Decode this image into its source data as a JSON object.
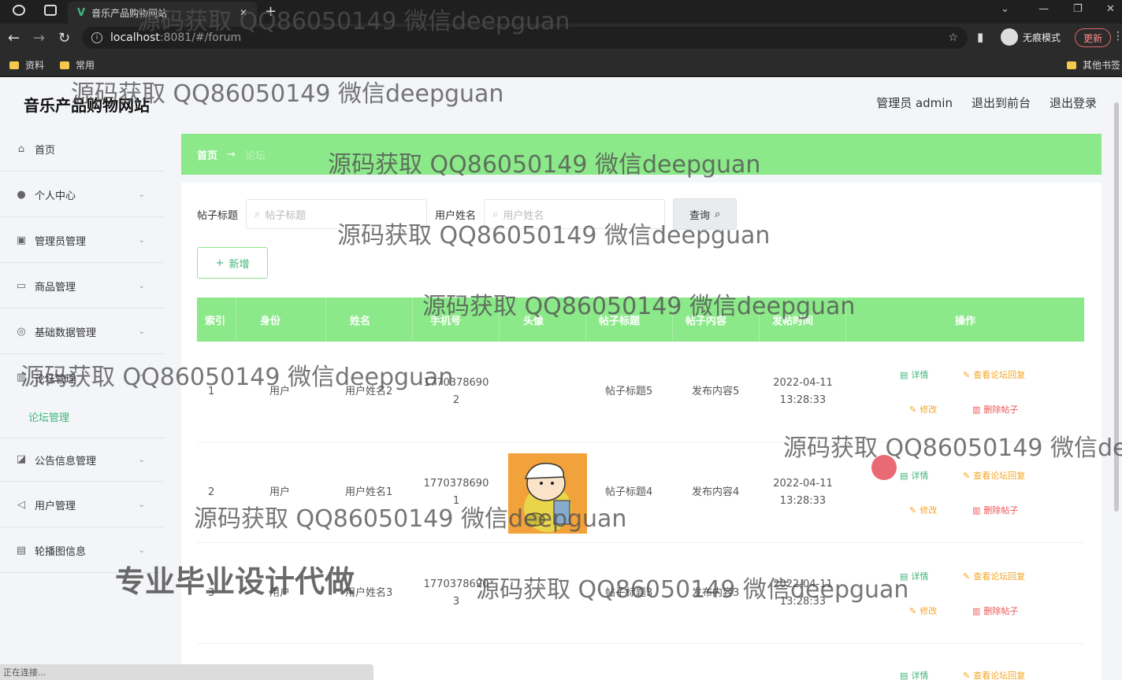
{
  "browser": {
    "tab_title": "音乐产品购物网站",
    "url_host": "localhost",
    "url_rest": ":8081/#/forum",
    "incognito_label": "无痕模式",
    "update_label": "更新",
    "bookmarks": [
      "资料",
      "常用"
    ],
    "other_bookmarks": "其他书签",
    "status_text": "正在连接..."
  },
  "app": {
    "site_title": "音乐产品购物网站",
    "top_links": [
      "管理员 admin",
      "退出到前台",
      "退出登录"
    ]
  },
  "sidebar": {
    "items": [
      {
        "label": "首页",
        "icon": "home-icon"
      },
      {
        "label": "个人中心",
        "icon": "user-icon"
      },
      {
        "label": "管理员管理",
        "icon": "admin-icon"
      },
      {
        "label": "商品管理",
        "icon": "goods-icon"
      },
      {
        "label": "基础数据管理",
        "icon": "data-icon"
      },
      {
        "label": "论坛管理",
        "icon": "forum-icon"
      },
      {
        "label": "公告信息管理",
        "icon": "notice-icon"
      },
      {
        "label": "用户管理",
        "icon": "send-icon"
      },
      {
        "label": "轮播图信息",
        "icon": "carousel-icon"
      }
    ],
    "sub_item": "论坛管理"
  },
  "breadcrumb": {
    "home": "首页",
    "arrow": "→",
    "current": "论坛"
  },
  "search": {
    "title_label": "帖子标题",
    "title_placeholder": "帖子标题",
    "user_label": "用户姓名",
    "user_placeholder": "用户姓名",
    "query_button": "查询"
  },
  "add_button": "新增",
  "table": {
    "headers": [
      "索引",
      "身份",
      "姓名",
      "手机号",
      "头像",
      "帖子标题",
      "帖子内容",
      "发帖时间",
      "操作"
    ],
    "rows": [
      {
        "index": "1",
        "identity": "用户",
        "name": "用户姓名2",
        "phone1": "1770378690",
        "phone2": "2",
        "title": "帖子标题5",
        "content": "发布内容5",
        "date": "2022-04-11",
        "time": "13:28:33"
      },
      {
        "index": "2",
        "identity": "用户",
        "name": "用户姓名1",
        "phone1": "1770378690",
        "phone2": "1",
        "title": "帖子标题4",
        "content": "发布内容4",
        "date": "2022-04-11",
        "time": "13:28:33"
      },
      {
        "index": "3",
        "identity": "用户",
        "name": "用户姓名3",
        "phone1": "1770378690",
        "phone2": "3",
        "title": "帖子标题3",
        "content": "发布内容3",
        "date": "2022-04-11",
        "time": "13:28:33"
      }
    ],
    "ops": {
      "detail": "详情",
      "view_reply": "查看论坛回复",
      "edit": "修改",
      "delete": "删除帖子"
    }
  },
  "watermark": "源码获取 QQ86050149 微信deepguan",
  "watermark_big": "专业毕业设计代做"
}
